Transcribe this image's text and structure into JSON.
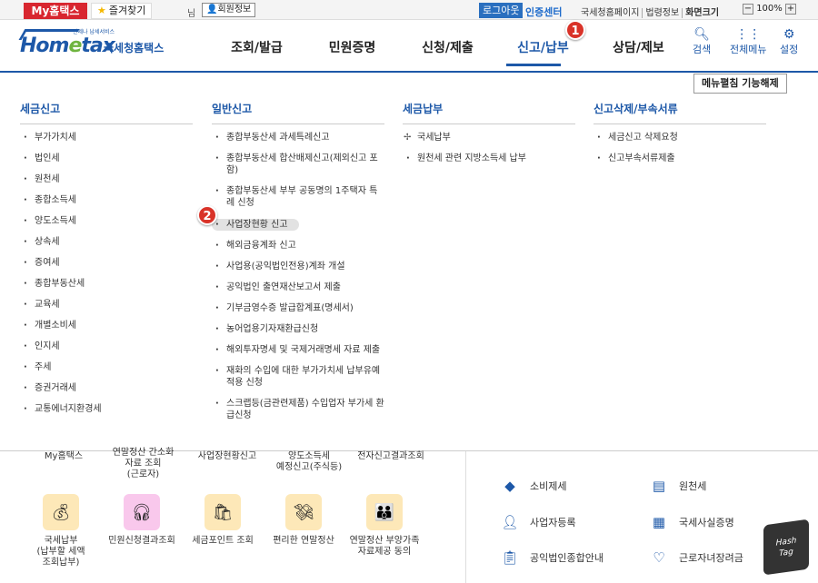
{
  "topbar": {
    "my_hometax": "My홈택스",
    "favorites": "즐겨찾기",
    "nim": "님",
    "member_info": "회원정보",
    "logout": "로그아웃",
    "cert_center": "인증센터",
    "links": [
      "국세청홈페이지",
      "법령정보",
      "화면크기"
    ],
    "zoom_minus": "−",
    "zoom_value": "100%",
    "zoom_plus": "+"
  },
  "header": {
    "logo_sub": "언제나 납세서비스",
    "logo_main_a": "Hom",
    "logo_main_e": "e",
    "logo_main_b": "tax",
    "logo_kr": "국세청홈택스",
    "gnb": [
      "조회/발급",
      "민원증명",
      "신청/제출",
      "신고/납부",
      "상담/제보"
    ],
    "icons": [
      {
        "label": "검색",
        "icon": "search-icon"
      },
      {
        "label": "전체메뉴",
        "icon": "grid-icon"
      },
      {
        "label": "설정",
        "icon": "gear-icon"
      }
    ],
    "badge1": "1"
  },
  "mega": {
    "menu_off": "메뉴펼침 기능해제",
    "badge2": "2",
    "columns": [
      {
        "title": "세금신고",
        "items": [
          "부가가치세",
          "법인세",
          "원천세",
          "종합소득세",
          "양도소득세",
          "상속세",
          "증여세",
          "종합부동산세",
          "교육세",
          "개별소비세",
          "인지세",
          "주세",
          "증권거래세",
          "교통에너지환경세"
        ]
      },
      {
        "title": "일반신고",
        "items": [
          "종합부동산세 과세특례신고",
          "종합부동산세 합산배제신고(제외신고 포함)",
          "종합부동산세 부부 공동명의 1주택자 특례 신청",
          "사업장현황 신고",
          "해외금융계좌 신고",
          "사업용(공익법인전용)계좌 개설",
          "공익법인 출연재산보고서 제출",
          "기부금영수증 발급합계표(명세서)",
          "농어업용기자재환급신청",
          "해외투자명세 및 국제거래명세 자료 제출",
          "재화의 수입에 대한 부가가치세 납부유예 적용 신청",
          "스크랩등(금관련제품) 수입업자 부가세 환급신청"
        ]
      },
      {
        "title": "세금납부",
        "items": [
          "국세납부",
          "원천세 관련 지방소득세 납부"
        ]
      },
      {
        "title": "신고삭제/부속서류",
        "items": [
          "세금신고 삭제요청",
          "신고부속서류제출"
        ]
      }
    ]
  },
  "bottom": {
    "cut_texts": [
      "My홈택스",
      "연말정산 간소화\n자료 조회\n(근로자)",
      "사업장현황신고",
      "양도소득세\n예정신고(주식등)",
      "전자신고결과조회"
    ],
    "services": [
      {
        "label": "국세납부\n(납부할 세액\n조회납부)",
        "icon": "coin-bag-icon"
      },
      {
        "label": "민원신청결과조회",
        "icon": "headset-icon"
      },
      {
        "label": "세금포인트 조회",
        "icon": "point-bag-icon"
      },
      {
        "label": "편리한 연말정산",
        "icon": "money-bag-icon"
      },
      {
        "label": "연말정산 부양가족\n자료제공 동의",
        "icon": "family-bag-icon"
      }
    ],
    "right_items": [
      {
        "label": "소비제세",
        "icon": "diamond-icon"
      },
      {
        "label": "원천세",
        "icon": "document-icon"
      },
      {
        "label": "사업자등록",
        "icon": "person-icon"
      },
      {
        "label": "국세사실증명",
        "icon": "certificate-icon"
      },
      {
        "label": "공익법인종합안내",
        "icon": "clipboard-icon"
      },
      {
        "label": "근로자녀장려금",
        "icon": "heart-icon"
      }
    ],
    "watermark": "Hash\nTag"
  }
}
